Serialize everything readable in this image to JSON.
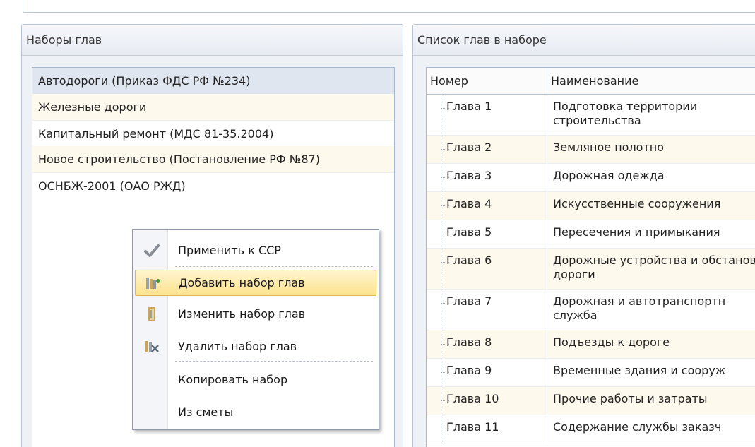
{
  "sets_panel": {
    "title": "Наборы глав",
    "items": [
      {
        "label": "Автодороги (Приказ ФДС РФ №234)",
        "selected": true
      },
      {
        "label": "Железные дороги",
        "selected": false
      },
      {
        "label": "Капитальный ремонт (МДС 81-35.2004)",
        "selected": false
      },
      {
        "label": "Новое строительство (Постановление РФ №87)",
        "selected": false
      },
      {
        "label": "ОСНБЖ-2001 (ОАО РЖД)",
        "selected": false
      }
    ]
  },
  "chapters_panel": {
    "title": "Список глав в наборе",
    "columns": [
      "Номер",
      "Наименование"
    ],
    "rows": [
      {
        "num": "Глава 1",
        "name": "Подготовка территории строительства"
      },
      {
        "num": "Глава 2",
        "name": "Земляное полотно"
      },
      {
        "num": "Глава 3",
        "name": "Дорожная одежда"
      },
      {
        "num": "Глава 4",
        "name": "Искусственные сооружения"
      },
      {
        "num": "Глава 5",
        "name": "Пересечения и примыкания"
      },
      {
        "num": "Глава 6",
        "name": "Дорожные устройства и обстановка дороги"
      },
      {
        "num": "Глава 7",
        "name": "Дорожная и автотранспортн служба"
      },
      {
        "num": "Глава 8",
        "name": "Подъезды к дороге"
      },
      {
        "num": "Глава 9",
        "name": "Временные здания и сооруж"
      },
      {
        "num": "Глава 10",
        "name": "Прочие работы и затраты"
      },
      {
        "num": "Глава 11",
        "name": "Содержание службы заказч"
      }
    ]
  },
  "context_menu": {
    "items": [
      {
        "label": "Применить к ССР",
        "icon": "checkmark-icon"
      },
      {
        "label": "Добавить набор глав",
        "icon": "add-set-icon",
        "highlighted": true
      },
      {
        "label": "Изменить набор глав",
        "icon": "edit-set-icon"
      },
      {
        "label": "Удалить набор глав",
        "icon": "delete-set-icon"
      },
      {
        "label": "Копировать набор",
        "icon": ""
      },
      {
        "label": "Из сметы",
        "icon": ""
      }
    ]
  },
  "colors": {
    "highlight": "#fce38e",
    "selected_row": "#dfe6f0",
    "alt_row": "#fdf9ec",
    "panel_border": "#b7c3d3"
  }
}
